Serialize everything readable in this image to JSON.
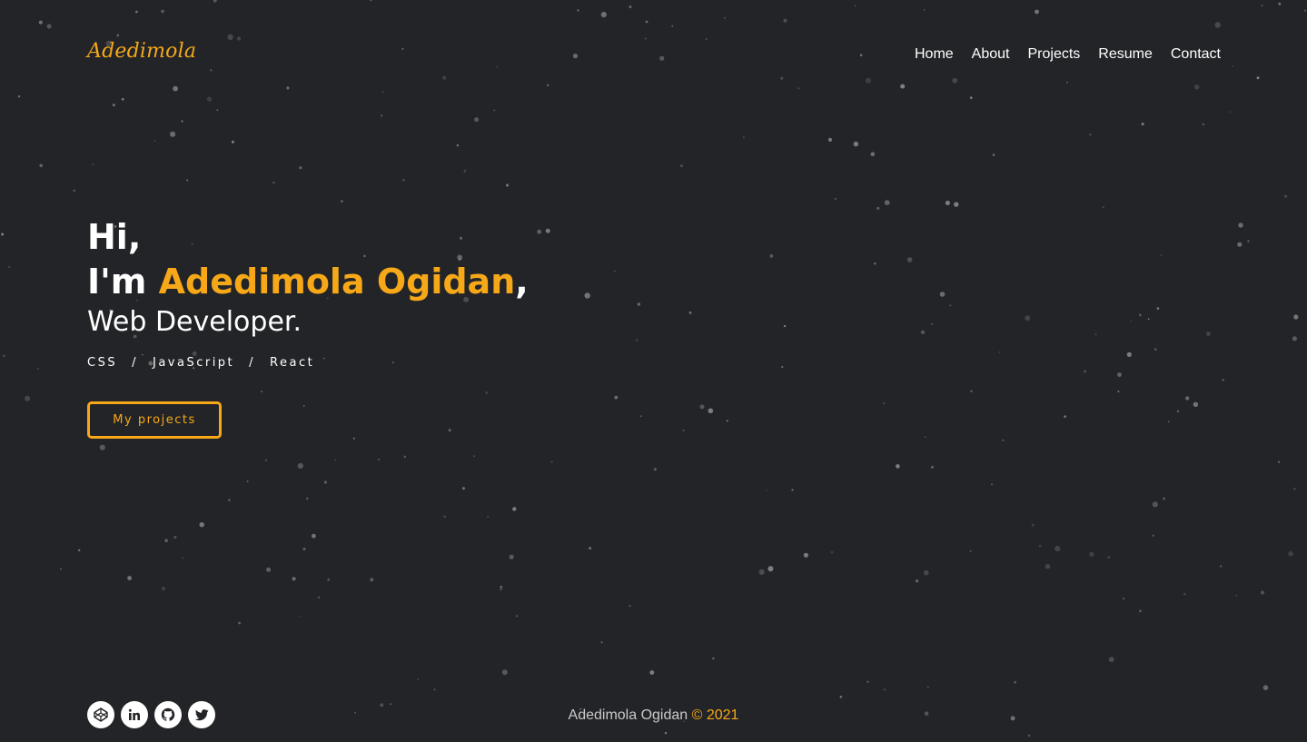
{
  "brand": {
    "logo_text": "Adedimola"
  },
  "nav": {
    "items": [
      "Home",
      "About",
      "Projects",
      "Resume",
      "Contact"
    ]
  },
  "hero": {
    "greeting": "Hi,",
    "intro_prefix": "I'm",
    "name": "Adedimola Ogidan",
    "intro_suffix": ",",
    "role": "Web Developer.",
    "skills": [
      "CSS",
      "JavaScript",
      "React"
    ],
    "skill_separator": "/",
    "cta_label": "My projects"
  },
  "socials": [
    {
      "icon": "codepen-icon"
    },
    {
      "icon": "linkedin-icon"
    },
    {
      "icon": "github-icon"
    },
    {
      "icon": "twitter-icon"
    }
  ],
  "footer": {
    "name": "Adedimola Ogidan",
    "copyright": "© 2021"
  },
  "colors": {
    "background": "#232427",
    "accent": "#f6a818",
    "text": "#ffffff",
    "muted": "#c9c9cb"
  }
}
